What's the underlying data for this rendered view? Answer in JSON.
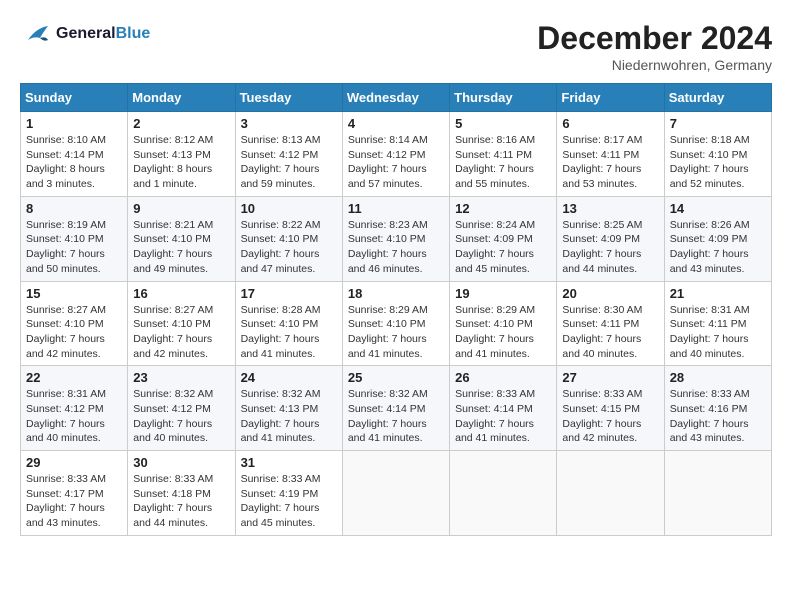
{
  "header": {
    "logo_line1": "General",
    "logo_line2": "Blue",
    "month": "December 2024",
    "location": "Niedernwohren, Germany"
  },
  "days_of_week": [
    "Sunday",
    "Monday",
    "Tuesday",
    "Wednesday",
    "Thursday",
    "Friday",
    "Saturday"
  ],
  "weeks": [
    [
      {
        "day": "1",
        "info": "Sunrise: 8:10 AM\nSunset: 4:14 PM\nDaylight: 8 hours\nand 3 minutes."
      },
      {
        "day": "2",
        "info": "Sunrise: 8:12 AM\nSunset: 4:13 PM\nDaylight: 8 hours\nand 1 minute."
      },
      {
        "day": "3",
        "info": "Sunrise: 8:13 AM\nSunset: 4:12 PM\nDaylight: 7 hours\nand 59 minutes."
      },
      {
        "day": "4",
        "info": "Sunrise: 8:14 AM\nSunset: 4:12 PM\nDaylight: 7 hours\nand 57 minutes."
      },
      {
        "day": "5",
        "info": "Sunrise: 8:16 AM\nSunset: 4:11 PM\nDaylight: 7 hours\nand 55 minutes."
      },
      {
        "day": "6",
        "info": "Sunrise: 8:17 AM\nSunset: 4:11 PM\nDaylight: 7 hours\nand 53 minutes."
      },
      {
        "day": "7",
        "info": "Sunrise: 8:18 AM\nSunset: 4:10 PM\nDaylight: 7 hours\nand 52 minutes."
      }
    ],
    [
      {
        "day": "8",
        "info": "Sunrise: 8:19 AM\nSunset: 4:10 PM\nDaylight: 7 hours\nand 50 minutes."
      },
      {
        "day": "9",
        "info": "Sunrise: 8:21 AM\nSunset: 4:10 PM\nDaylight: 7 hours\nand 49 minutes."
      },
      {
        "day": "10",
        "info": "Sunrise: 8:22 AM\nSunset: 4:10 PM\nDaylight: 7 hours\nand 47 minutes."
      },
      {
        "day": "11",
        "info": "Sunrise: 8:23 AM\nSunset: 4:10 PM\nDaylight: 7 hours\nand 46 minutes."
      },
      {
        "day": "12",
        "info": "Sunrise: 8:24 AM\nSunset: 4:09 PM\nDaylight: 7 hours\nand 45 minutes."
      },
      {
        "day": "13",
        "info": "Sunrise: 8:25 AM\nSunset: 4:09 PM\nDaylight: 7 hours\nand 44 minutes."
      },
      {
        "day": "14",
        "info": "Sunrise: 8:26 AM\nSunset: 4:09 PM\nDaylight: 7 hours\nand 43 minutes."
      }
    ],
    [
      {
        "day": "15",
        "info": "Sunrise: 8:27 AM\nSunset: 4:10 PM\nDaylight: 7 hours\nand 42 minutes."
      },
      {
        "day": "16",
        "info": "Sunrise: 8:27 AM\nSunset: 4:10 PM\nDaylight: 7 hours\nand 42 minutes."
      },
      {
        "day": "17",
        "info": "Sunrise: 8:28 AM\nSunset: 4:10 PM\nDaylight: 7 hours\nand 41 minutes."
      },
      {
        "day": "18",
        "info": "Sunrise: 8:29 AM\nSunset: 4:10 PM\nDaylight: 7 hours\nand 41 minutes."
      },
      {
        "day": "19",
        "info": "Sunrise: 8:29 AM\nSunset: 4:10 PM\nDaylight: 7 hours\nand 41 minutes."
      },
      {
        "day": "20",
        "info": "Sunrise: 8:30 AM\nSunset: 4:11 PM\nDaylight: 7 hours\nand 40 minutes."
      },
      {
        "day": "21",
        "info": "Sunrise: 8:31 AM\nSunset: 4:11 PM\nDaylight: 7 hours\nand 40 minutes."
      }
    ],
    [
      {
        "day": "22",
        "info": "Sunrise: 8:31 AM\nSunset: 4:12 PM\nDaylight: 7 hours\nand 40 minutes."
      },
      {
        "day": "23",
        "info": "Sunrise: 8:32 AM\nSunset: 4:12 PM\nDaylight: 7 hours\nand 40 minutes."
      },
      {
        "day": "24",
        "info": "Sunrise: 8:32 AM\nSunset: 4:13 PM\nDaylight: 7 hours\nand 41 minutes."
      },
      {
        "day": "25",
        "info": "Sunrise: 8:32 AM\nSunset: 4:14 PM\nDaylight: 7 hours\nand 41 minutes."
      },
      {
        "day": "26",
        "info": "Sunrise: 8:33 AM\nSunset: 4:14 PM\nDaylight: 7 hours\nand 41 minutes."
      },
      {
        "day": "27",
        "info": "Sunrise: 8:33 AM\nSunset: 4:15 PM\nDaylight: 7 hours\nand 42 minutes."
      },
      {
        "day": "28",
        "info": "Sunrise: 8:33 AM\nSunset: 4:16 PM\nDaylight: 7 hours\nand 43 minutes."
      }
    ],
    [
      {
        "day": "29",
        "info": "Sunrise: 8:33 AM\nSunset: 4:17 PM\nDaylight: 7 hours\nand 43 minutes."
      },
      {
        "day": "30",
        "info": "Sunrise: 8:33 AM\nSunset: 4:18 PM\nDaylight: 7 hours\nand 44 minutes."
      },
      {
        "day": "31",
        "info": "Sunrise: 8:33 AM\nSunset: 4:19 PM\nDaylight: 7 hours\nand 45 minutes."
      },
      {
        "day": "",
        "info": ""
      },
      {
        "day": "",
        "info": ""
      },
      {
        "day": "",
        "info": ""
      },
      {
        "day": "",
        "info": ""
      }
    ]
  ]
}
